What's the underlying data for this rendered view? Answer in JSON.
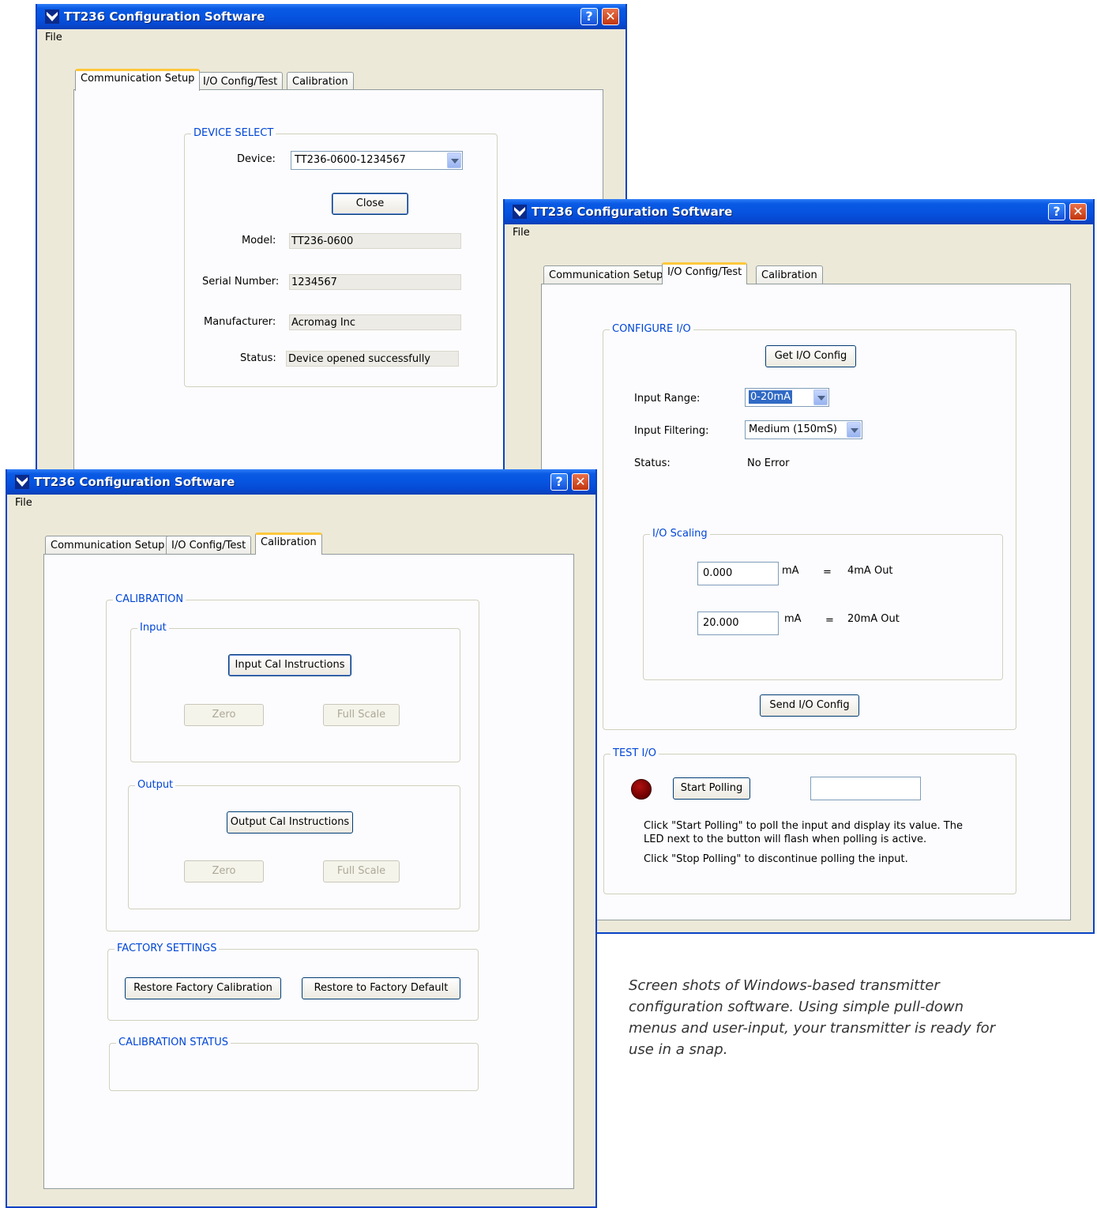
{
  "app": {
    "title": "TT236 Configuration Software",
    "help_label": "?",
    "close_label": "✕",
    "menu_file": "File",
    "tabs": [
      "Communication Setup",
      "I/O Config/Test",
      "Calibration"
    ]
  },
  "comm_window": {
    "group_title": "DEVICE SELECT",
    "device_label": "Device:",
    "device_value": "TT236-0600-1234567",
    "close_button": "Close",
    "model_label": "Model:",
    "model_value": "TT236-0600",
    "serial_label": "Serial Number:",
    "serial_value": "1234567",
    "manufacturer_label": "Manufacturer:",
    "manufacturer_value": "Acromag Inc",
    "status_label": "Status:",
    "status_value": "Device opened successfully"
  },
  "io_window": {
    "configure_title": "CONFIGURE I/O",
    "get_config_button": "Get I/O Config",
    "input_range_label": "Input Range:",
    "input_range_value": "0-20mA",
    "input_filtering_label": "Input Filtering:",
    "input_filtering_value": "Medium (150mS)",
    "status_label": "Status:",
    "status_value": "No Error",
    "scaling_title": "I/O Scaling",
    "scale_low_value": "0.000",
    "scale_low_unit": "mA",
    "scale_low_eq": "=",
    "scale_low_out": "4mA Out",
    "scale_high_value": "20.000",
    "scale_high_unit": "mA",
    "scale_high_eq": "=",
    "scale_high_out": "20mA Out",
    "send_config_button": "Send I/O Config",
    "test_title": "TEST I/O",
    "start_polling_button": "Start Polling",
    "poll_value": "",
    "help_line1": "Click \"Start Polling\" to poll the input and display its value. The",
    "help_line2": "LED next to the button will flash when polling is active.",
    "help_line3": "Click \"Stop Polling\" to discontinue polling the input."
  },
  "cal_window": {
    "calibration_title": "CALIBRATION",
    "input_title": "Input",
    "input_instructions_button": "Input Cal Instructions",
    "input_zero_button": "Zero",
    "input_full_scale_button": "Full Scale",
    "output_title": "Output",
    "output_instructions_button": "Output Cal Instructions",
    "output_zero_button": "Zero",
    "output_full_scale_button": "Full Scale",
    "factory_title": "FACTORY SETTINGS",
    "restore_cal_button": "Restore Factory Calibration",
    "restore_default_button": "Restore to Factory Default",
    "status_title": "CALIBRATION STATUS"
  },
  "caption": "Screen shots of Windows-based transmitter configuration software. Using simple pull-down menus and user-input, your transmitter is ready for use in a snap.",
  "colors": {
    "titlebar": "#0654e0",
    "window_bg": "#ece9d8",
    "group_title": "#0046d5",
    "active_tab_highlight": "#ffc83c",
    "led": "#8b0000"
  }
}
